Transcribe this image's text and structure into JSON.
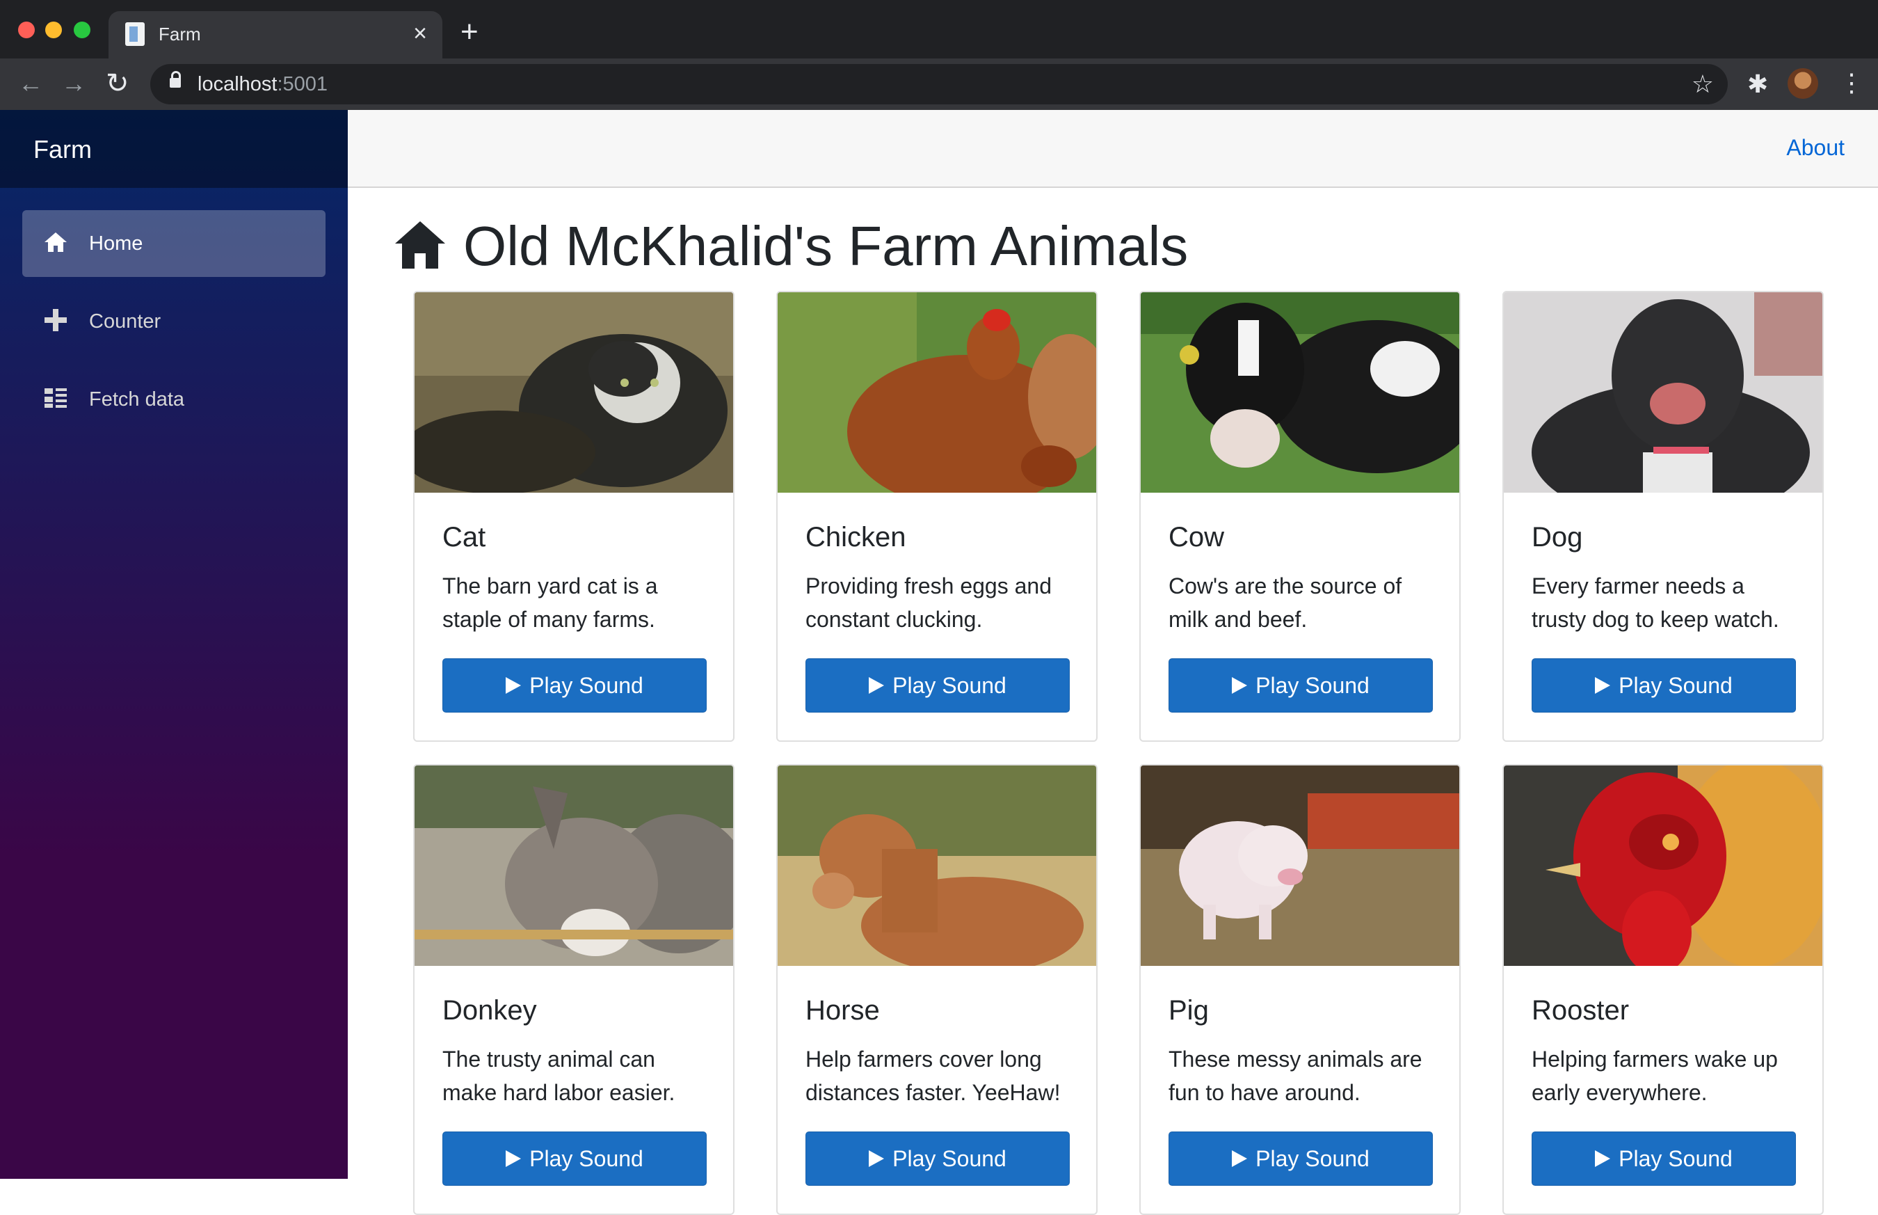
{
  "browser": {
    "tab_title": "Farm",
    "tab_close": "×",
    "new_tab": "+",
    "url_host": "localhost",
    "url_port": ":5001"
  },
  "sidebar": {
    "brand": "Farm",
    "items": [
      {
        "label": "Home",
        "active": true,
        "icon": "home-icon"
      },
      {
        "label": "Counter",
        "active": false,
        "icon": "plus-icon"
      },
      {
        "label": "Fetch data",
        "active": false,
        "icon": "list-icon"
      }
    ]
  },
  "topbar": {
    "about_label": "About"
  },
  "page": {
    "title": "Old McKhalid's Farm Animals"
  },
  "cards": [
    {
      "name": "Cat",
      "text": "The barn yard cat is a staple of many farms.",
      "button": "Play Sound"
    },
    {
      "name": "Chicken",
      "text": "Providing fresh eggs and constant clucking.",
      "button": "Play Sound"
    },
    {
      "name": "Cow",
      "text": "Cow's are the source of milk and beef.",
      "button": "Play Sound"
    },
    {
      "name": "Dog",
      "text": "Every farmer needs a trusty dog to keep watch.",
      "button": "Play Sound"
    },
    {
      "name": "Donkey",
      "text": "The trusty animal can make hard labor easier.",
      "button": "Play Sound"
    },
    {
      "name": "Horse",
      "text": "Help farmers cover long distances faster. YeeHaw!",
      "button": "Play Sound"
    },
    {
      "name": "Pig",
      "text": "These messy animals are fun to have around.",
      "button": "Play Sound"
    },
    {
      "name": "Rooster",
      "text": "Helping farmers wake up early everywhere.",
      "button": "Play Sound"
    }
  ],
  "colors": {
    "accent": "#1b6ec2",
    "link": "#0366d6",
    "sidebar_top": "#052767",
    "sidebar_bottom": "#3a0647"
  }
}
